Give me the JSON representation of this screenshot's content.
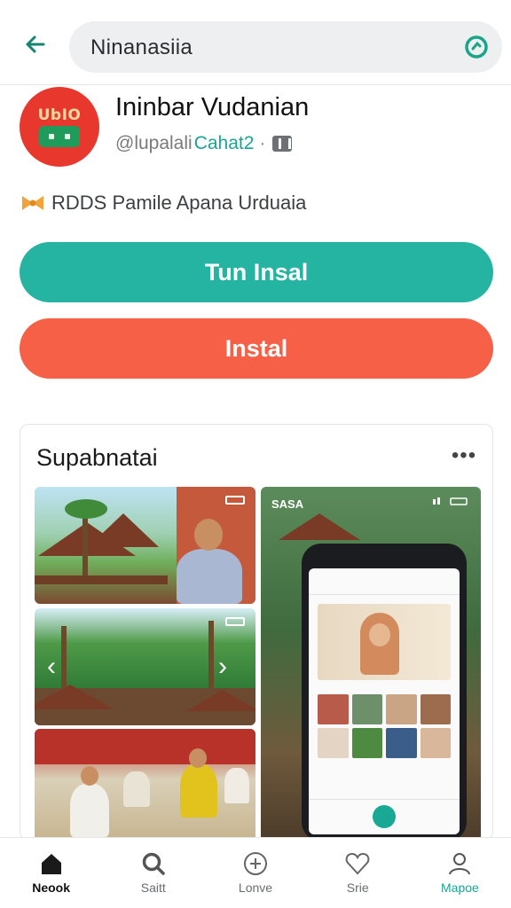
{
  "colors": {
    "accent_teal": "#25b3a2",
    "accent_orange": "#f56046",
    "icon_red": "#e8372c",
    "link_teal": "#18a596"
  },
  "search": {
    "query": "Ninanasiia",
    "back_icon": "arrow-left-icon",
    "go_icon": "refresh-check-icon"
  },
  "app": {
    "icon_text": "UbIO",
    "title": "Ininbar Vudanian",
    "developer_handle": "@lupalali",
    "developer_name": "Cahat2",
    "dots": "·",
    "badge_icon": "pause-badge-icon",
    "rating_icon": "bow-icon",
    "rating_text": "RDDS Pamile Apana Urduaia"
  },
  "buttons": {
    "primary_label": "Tun Insal",
    "secondary_label": "Instal"
  },
  "screenshots": {
    "title": "Supabnatai",
    "more_label": "•••",
    "phone_title": "SASA",
    "prev_arrow": "‹",
    "next_arrow": "›"
  },
  "bottom_nav": {
    "items": [
      {
        "label": "Neook",
        "icon": "home-icon"
      },
      {
        "label": "Saitt",
        "icon": "search-icon"
      },
      {
        "label": "Lonve",
        "icon": "plus-circle-icon"
      },
      {
        "label": "Srie",
        "icon": "heart-icon"
      },
      {
        "label": "Mapoe",
        "icon": "profile-icon"
      }
    ]
  }
}
